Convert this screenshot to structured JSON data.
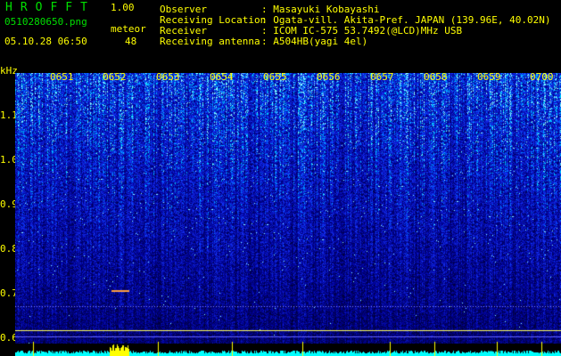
{
  "app": {
    "logo": "HROFFT",
    "version": "1.00"
  },
  "file": {
    "name": "0510280650.png",
    "datetime": "05.10.28 06:50"
  },
  "counter": {
    "label": "meteor",
    "value": "48"
  },
  "info": [
    {
      "key": "Observer",
      "value": ": Masayuki Kobayashi"
    },
    {
      "key": "Receiving Location",
      "value": ": Ogata-vill. Akita-Pref. JAPAN (139.96E, 40.02N)"
    },
    {
      "key": "Receiver",
      "value": ": ICOM IC-575 53.7492(@LCD)MHz USB"
    },
    {
      "key": "Receiving antenna",
      "value": ": A504HB(yagi 4el)"
    }
  ],
  "axis": {
    "y_unit": "kHz",
    "y_ticks": [
      "1.1",
      "1.0",
      "0.9",
      "0.8",
      "0.7",
      "0.6"
    ],
    "x_ticks": [
      "0651",
      "0652",
      "0653",
      "0654",
      "0655",
      "0656",
      "0657",
      "0658",
      "0659",
      "0700"
    ]
  },
  "colors": {
    "background": "#000000",
    "text_yellow": "#ffff00",
    "logo_green": "#00e000",
    "spectrum_dark": "#000060",
    "spectrum_mid": "#1030ff",
    "spectrum_high": "#00ffff",
    "meter_bar": "#00ffff",
    "meter_peak": "#ffff00"
  }
}
